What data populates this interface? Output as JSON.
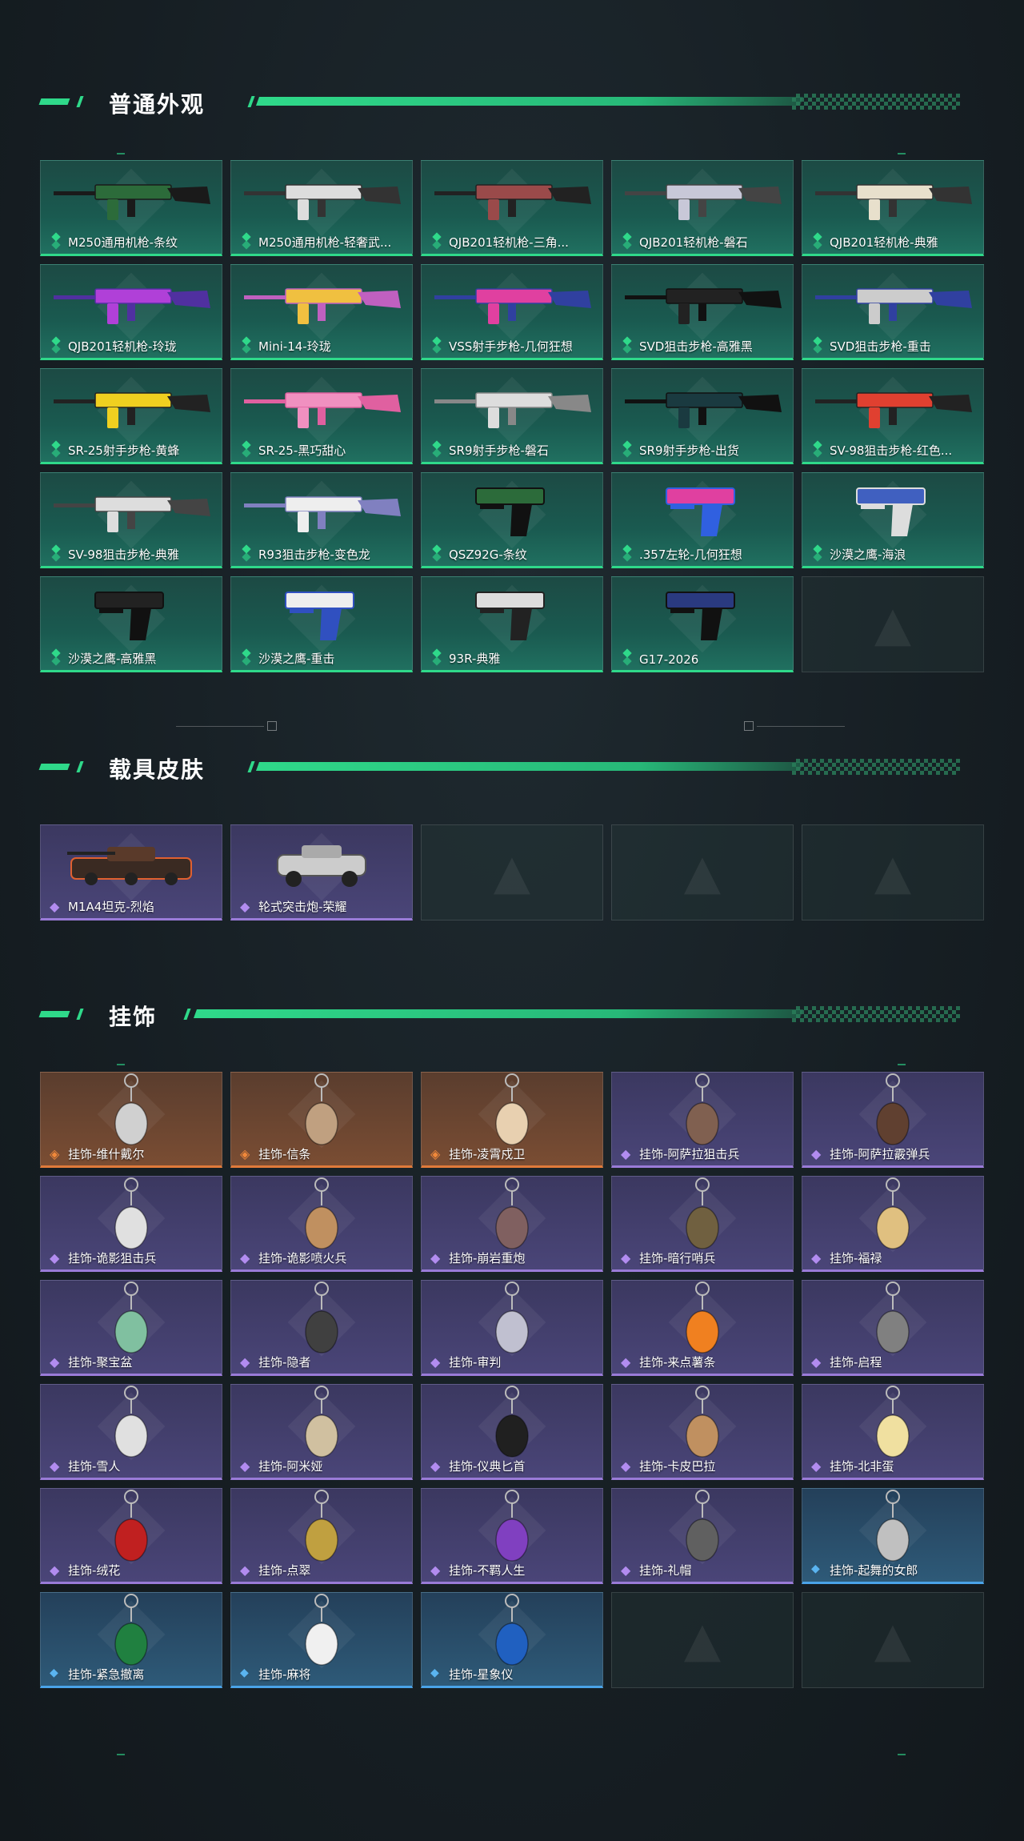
{
  "sections": [
    {
      "title": "普通外观"
    },
    {
      "title": "载具皮肤"
    },
    {
      "title": "挂饰"
    }
  ],
  "weapons": [
    {
      "label": "M250通用机枪-条纹",
      "rarity": "green"
    },
    {
      "label": "M250通用机枪-轻奢武...",
      "rarity": "green"
    },
    {
      "label": "QJB201轻机枪-三角...",
      "rarity": "green"
    },
    {
      "label": "QJB201轻机枪-磐石",
      "rarity": "green"
    },
    {
      "label": "QJB201轻机枪-典雅",
      "rarity": "green"
    },
    {
      "label": "QJB201轻机枪-玲珑",
      "rarity": "green"
    },
    {
      "label": "Mini-14-玲珑",
      "rarity": "green"
    },
    {
      "label": "VSS射手步枪-几何狂想",
      "rarity": "green"
    },
    {
      "label": "SVD狙击步枪-高雅黑",
      "rarity": "green"
    },
    {
      "label": "SVD狙击步枪-重击",
      "rarity": "green"
    },
    {
      "label": "SR-25射手步枪-黄蜂",
      "rarity": "green"
    },
    {
      "label": "SR-25-黑巧甜心",
      "rarity": "green"
    },
    {
      "label": "SR9射手步枪-磐石",
      "rarity": "green"
    },
    {
      "label": "SR9射手步枪-出货",
      "rarity": "green"
    },
    {
      "label": "SV-98狙击步枪-红色...",
      "rarity": "green"
    },
    {
      "label": "SV-98狙击步枪-典雅",
      "rarity": "green"
    },
    {
      "label": "R93狙击步枪-变色龙",
      "rarity": "green"
    },
    {
      "label": "QSZ92G-条纹",
      "rarity": "green"
    },
    {
      "label": ".357左轮-几何狂想",
      "rarity": "green"
    },
    {
      "label": "沙漠之鹰-海浪",
      "rarity": "green"
    },
    {
      "label": "沙漠之鹰-高雅黑",
      "rarity": "green"
    },
    {
      "label": "沙漠之鹰-重击",
      "rarity": "green"
    },
    {
      "label": "93R-典雅",
      "rarity": "green"
    },
    {
      "label": "G17-2026",
      "rarity": "green"
    }
  ],
  "vehicles": [
    {
      "label": "M1A4坦克-烈焰",
      "rarity": "purple"
    },
    {
      "label": "轮式突击炮-荣耀",
      "rarity": "purple"
    }
  ],
  "charms": [
    {
      "label": "挂饰-维什戴尔",
      "rarity": "orange"
    },
    {
      "label": "挂饰-信条",
      "rarity": "orange"
    },
    {
      "label": "挂饰-凌霄戍卫",
      "rarity": "orange"
    },
    {
      "label": "挂饰-阿萨拉狙击兵",
      "rarity": "purple"
    },
    {
      "label": "挂饰-阿萨拉霰弹兵",
      "rarity": "purple"
    },
    {
      "label": "挂饰-诡影狙击兵",
      "rarity": "purple"
    },
    {
      "label": "挂饰-诡影喷火兵",
      "rarity": "purple"
    },
    {
      "label": "挂饰-崩岩重炮",
      "rarity": "purple"
    },
    {
      "label": "挂饰-暗行哨兵",
      "rarity": "purple"
    },
    {
      "label": "挂饰-福禄",
      "rarity": "purple"
    },
    {
      "label": "挂饰-聚宝盆",
      "rarity": "purple"
    },
    {
      "label": "挂饰-隐者",
      "rarity": "purple"
    },
    {
      "label": "挂饰-审判",
      "rarity": "purple"
    },
    {
      "label": "挂饰-来点薯条",
      "rarity": "purple"
    },
    {
      "label": "挂饰-启程",
      "rarity": "purple"
    },
    {
      "label": "挂饰-雪人",
      "rarity": "purple"
    },
    {
      "label": "挂饰-阿米娅",
      "rarity": "purple"
    },
    {
      "label": "挂饰-仪典匕首",
      "rarity": "purple"
    },
    {
      "label": "挂饰-卡皮巴拉",
      "rarity": "purple"
    },
    {
      "label": "挂饰-北非蛋",
      "rarity": "purple"
    },
    {
      "label": "挂饰-绒花",
      "rarity": "purple"
    },
    {
      "label": "挂饰-点翠",
      "rarity": "purple"
    },
    {
      "label": "挂饰-不羁人生",
      "rarity": "purple"
    },
    {
      "label": "挂饰-礼帽",
      "rarity": "purple"
    },
    {
      "label": "挂饰-起舞的女郎",
      "rarity": "blue"
    },
    {
      "label": "挂饰-紧急撤离",
      "rarity": "blue"
    },
    {
      "label": "挂饰-麻将",
      "rarity": "blue"
    },
    {
      "label": "挂饰-星象仪",
      "rarity": "blue"
    }
  ],
  "colors": {
    "accent_green": "#2fd98a",
    "rarity_purple": "#9a7bd8",
    "rarity_orange": "#e07a3a",
    "rarity_blue": "#4aa3e8"
  }
}
